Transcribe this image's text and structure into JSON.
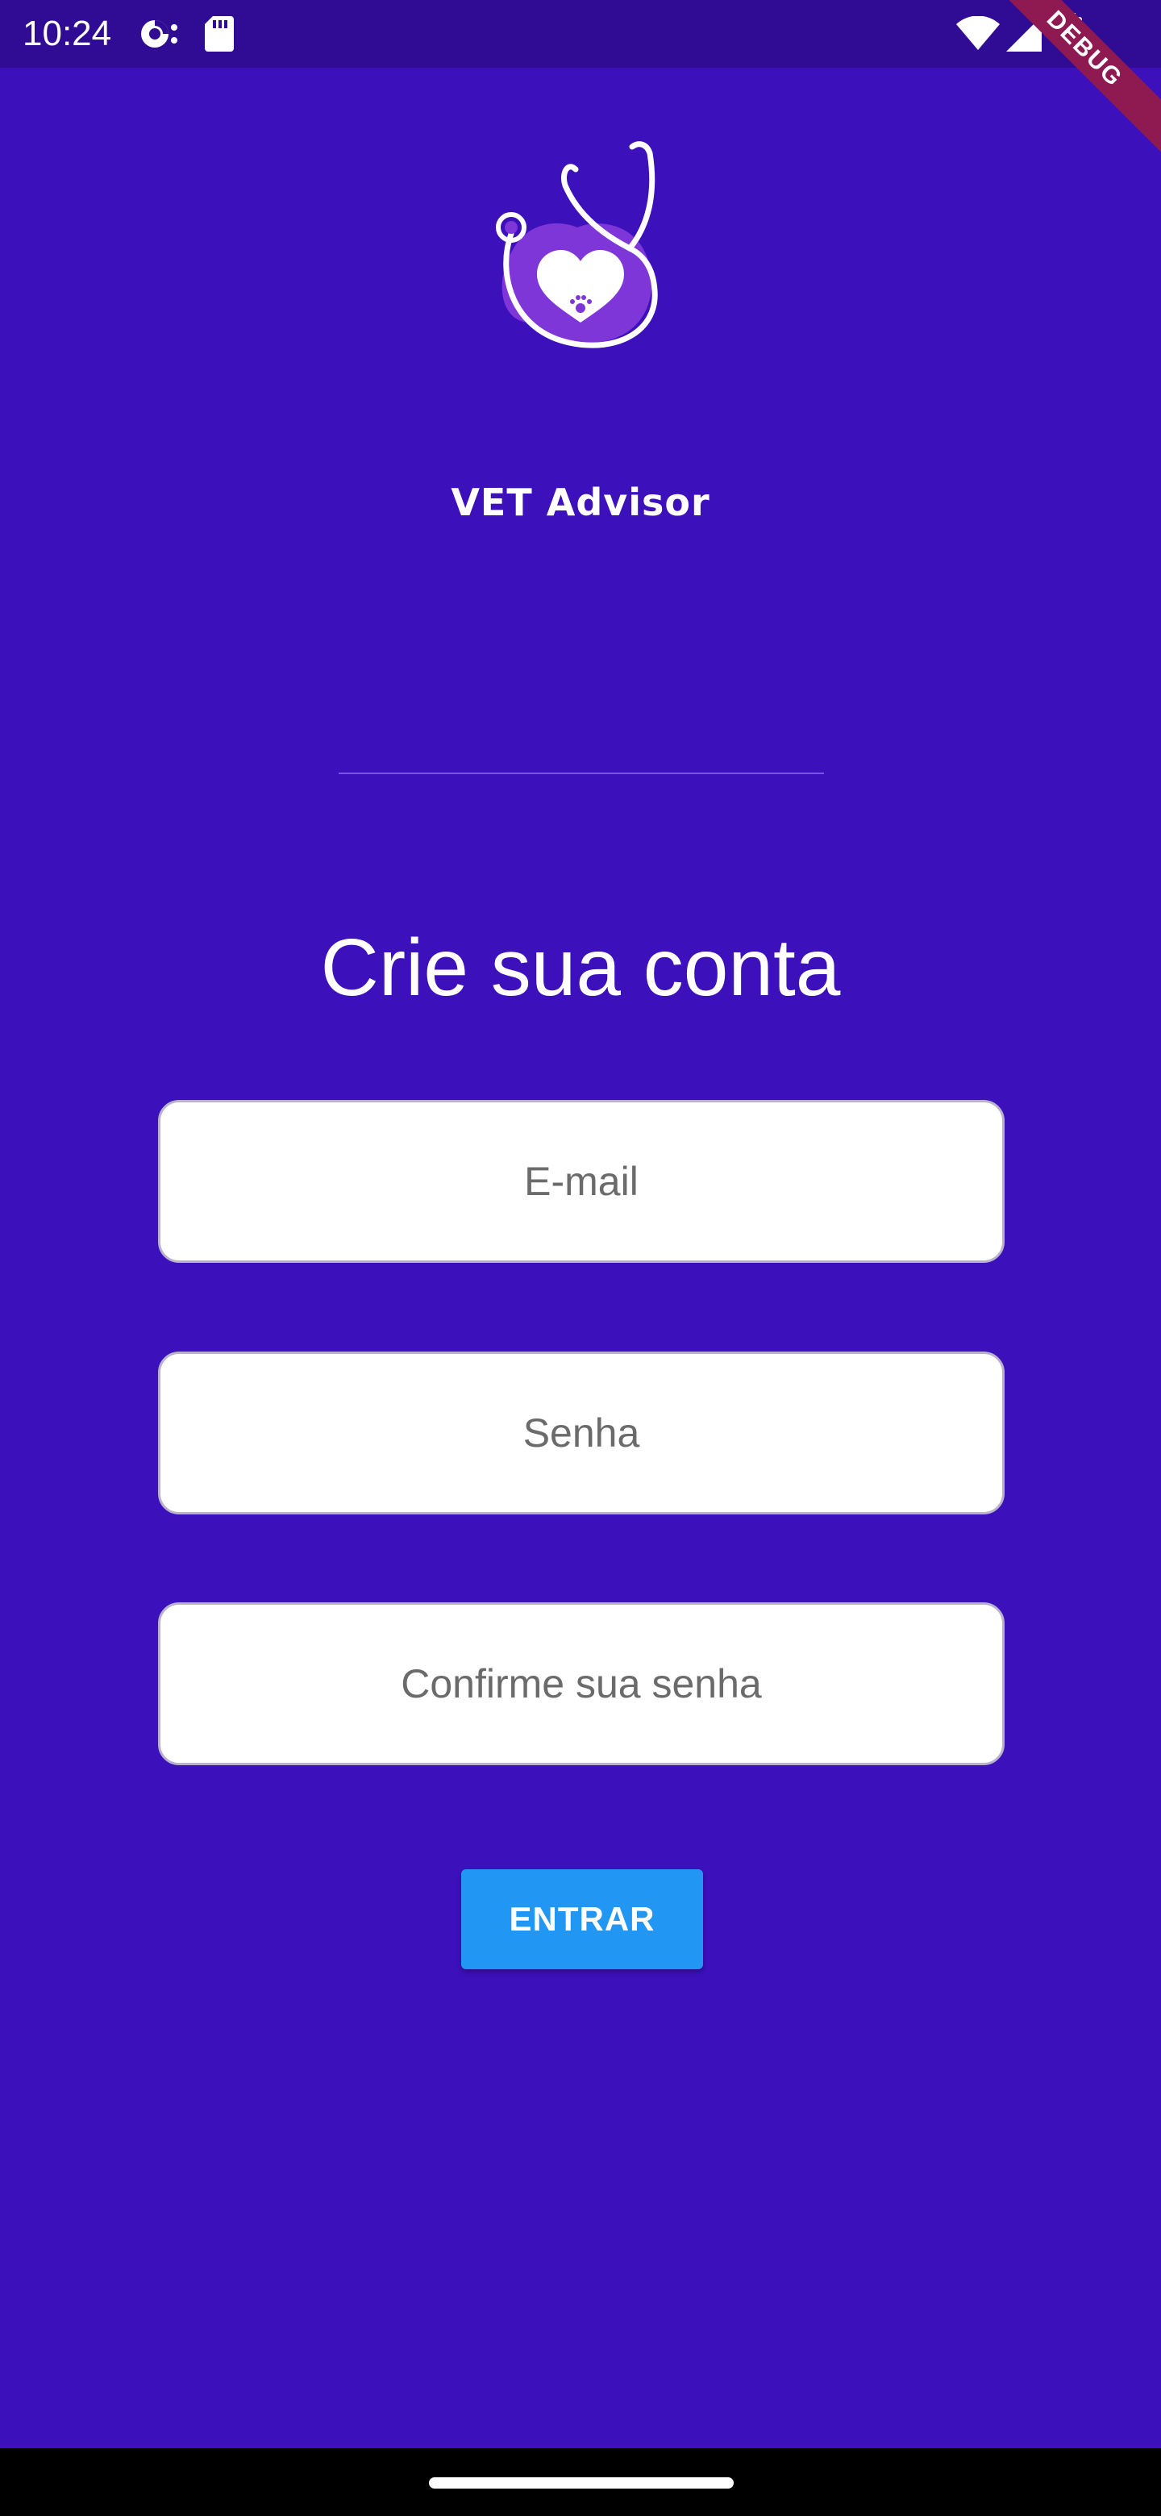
{
  "status_bar": {
    "time": "10:24"
  },
  "debug_banner": "DEBUG",
  "app": {
    "name": "VET Advisor"
  },
  "page": {
    "title": "Crie sua conta"
  },
  "form": {
    "email": {
      "placeholder": "E-mail",
      "value": ""
    },
    "password": {
      "placeholder": "Senha",
      "value": ""
    },
    "confirm_password": {
      "placeholder": "Confirme sua senha",
      "value": ""
    },
    "submit_label": "ENTRAR"
  },
  "colors": {
    "background": "#3c10bb",
    "status_bar": "#2f0c93",
    "button": "#2196f3",
    "debug_ribbon": "#8f1a52"
  },
  "icons": [
    "pocket-casts-icon",
    "sd-card-icon",
    "wifi-icon",
    "cellular-signal-icon",
    "battery-icon",
    "stethoscope-heart-logo"
  ]
}
